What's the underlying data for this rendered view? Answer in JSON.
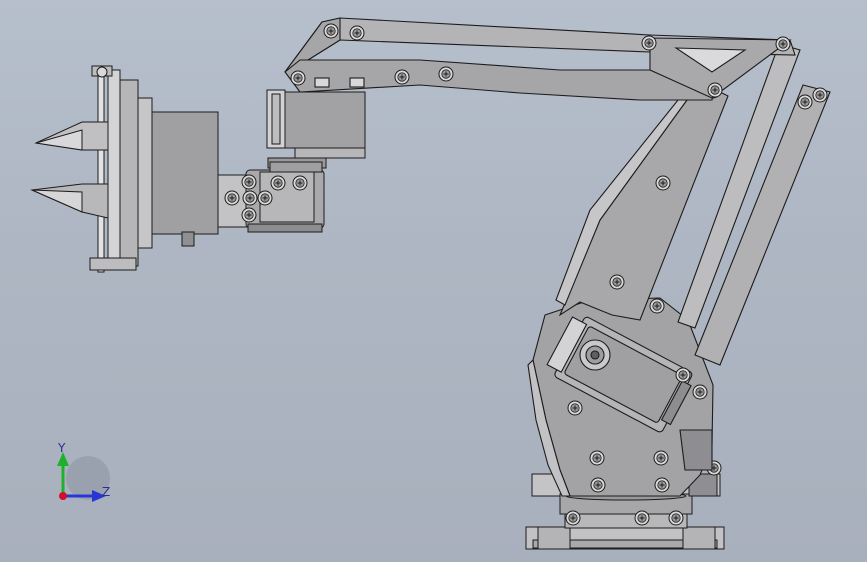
{
  "viewport": {
    "background_top": "#b6bfcc",
    "background_bottom": "#a9b0bd"
  },
  "model": {
    "part_fill": "#a9a9ab",
    "part_dark": "#7e7e82",
    "part_light": "#c9c9cc",
    "edge_color": "#1c1c1c",
    "screw_fill": "#d6d6d6"
  },
  "triad": {
    "y_label": "Y",
    "z_label": "Z",
    "y_color": "#1fb02c",
    "z_color": "#2a35d8",
    "origin_color": "#d0102a"
  }
}
